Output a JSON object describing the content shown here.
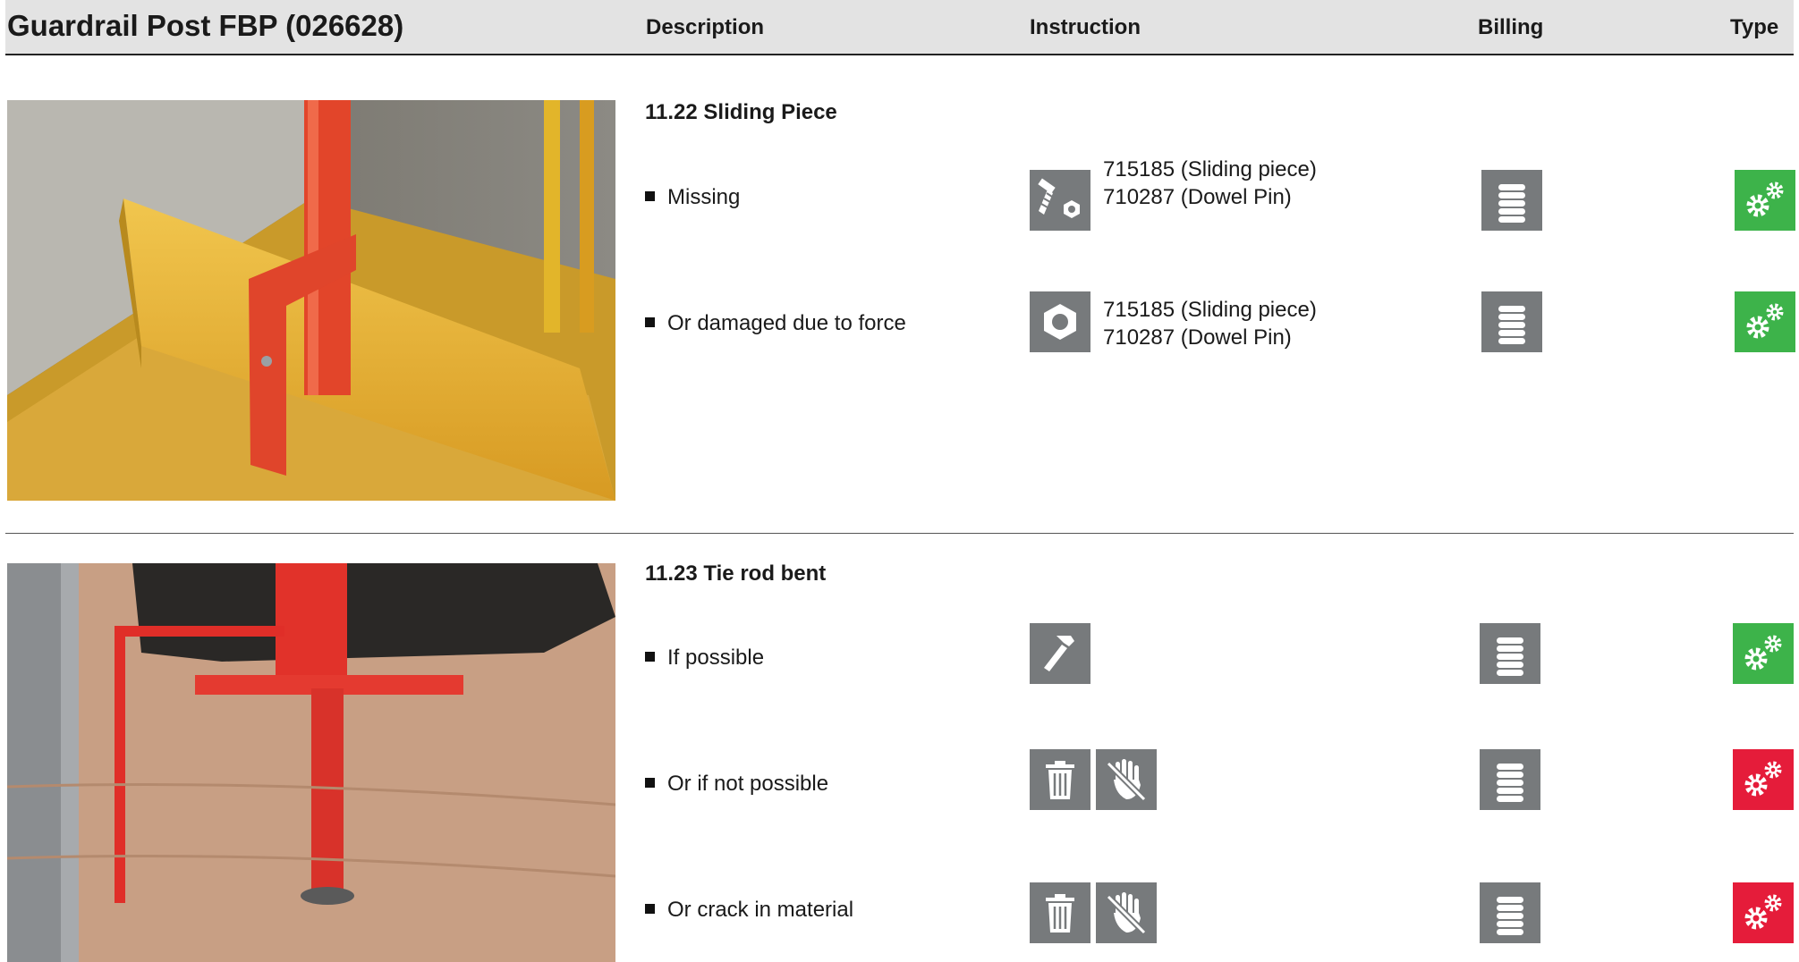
{
  "header": {
    "title": "Guardrail Post FBP (026628)",
    "col_description": "Description",
    "col_instruction": "Instruction",
    "col_billing": "Billing",
    "col_type": "Type"
  },
  "sections": [
    {
      "title": "11.22 Sliding Piece",
      "items": [
        {
          "description": "Or damaged due to force",
          "instruction_icons": [
            "nut-icon"
          ],
          "instruction_lines": [
            "715185 (Sliding piece)",
            "710287 (Dowel Pin)"
          ],
          "billing_icon": "coin-stack-icon",
          "type_icon": "gears-icon",
          "type_color": "#3db34a"
        },
        {
          "description": "Missing",
          "instruction_icons": [
            "bolt-nut-icon"
          ],
          "instruction_lines": [
            "715185 (Sliding piece)",
            "710287 (Dowel Pin)"
          ],
          "billing_icon": "coin-stack-icon",
          "type_icon": "gears-icon",
          "type_color": "#3db34a"
        }
      ]
    },
    {
      "title": "11.23 Tie rod bent",
      "items": [
        {
          "description": "If possible",
          "instruction_icons": [
            "hammer-icon"
          ],
          "billing_icon": "coin-stack-icon",
          "type_icon": "gears-icon",
          "type_color": "#3db34a"
        },
        {
          "description": "Or if not possible",
          "instruction_icons": [
            "trash-icon",
            "no-touch-icon"
          ],
          "billing_icon": "coin-stack-icon",
          "type_icon": "gears-icon",
          "type_color": "#e51c3a"
        },
        {
          "description": "Or crack in material",
          "instruction_icons": [
            "trash-icon",
            "no-touch-icon"
          ],
          "billing_icon": "coin-stack-icon",
          "type_icon": "gears-icon",
          "type_color": "#e51c3a"
        }
      ]
    }
  ]
}
